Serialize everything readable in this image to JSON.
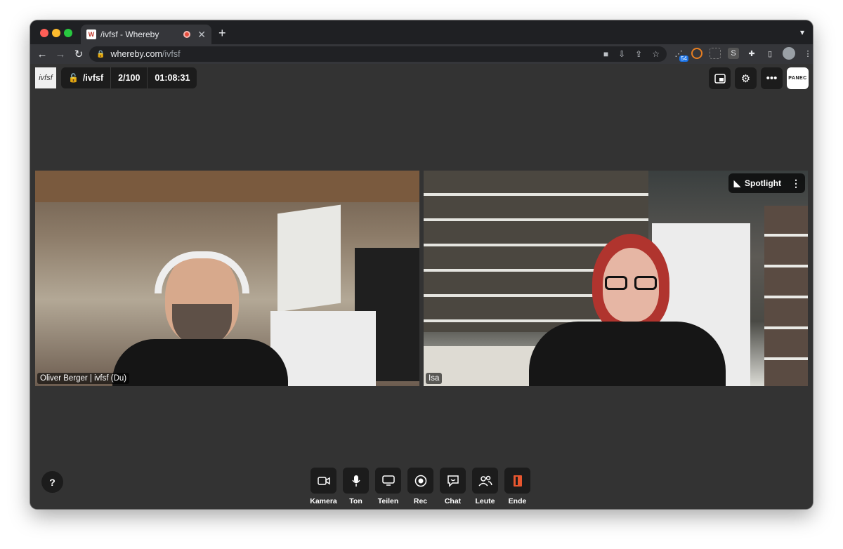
{
  "browser": {
    "tab_title": "/ivfsf - Whereby",
    "favicon_letter": "W",
    "url_host": "whereby.com",
    "url_path": "/ivfsf",
    "extension_badge": "54"
  },
  "room": {
    "logo_text": "ivfsf",
    "name": "/ivfsf",
    "participants": "2/100",
    "timer": "01:08:31",
    "brand_text": "PANEC"
  },
  "videos": {
    "left_name": "Oliver Berger | ivfsf (Du)",
    "right_name": "Isa",
    "spotlight_label": "Spotlight"
  },
  "controls": {
    "help": "?",
    "camera": "Kamera",
    "sound": "Ton",
    "share": "Teilen",
    "record": "Rec",
    "chat": "Chat",
    "people": "Leute",
    "end": "Ende"
  },
  "colors": {
    "accent_end": "#e8562f",
    "recording": "#e74c3c",
    "background": "#333333"
  }
}
